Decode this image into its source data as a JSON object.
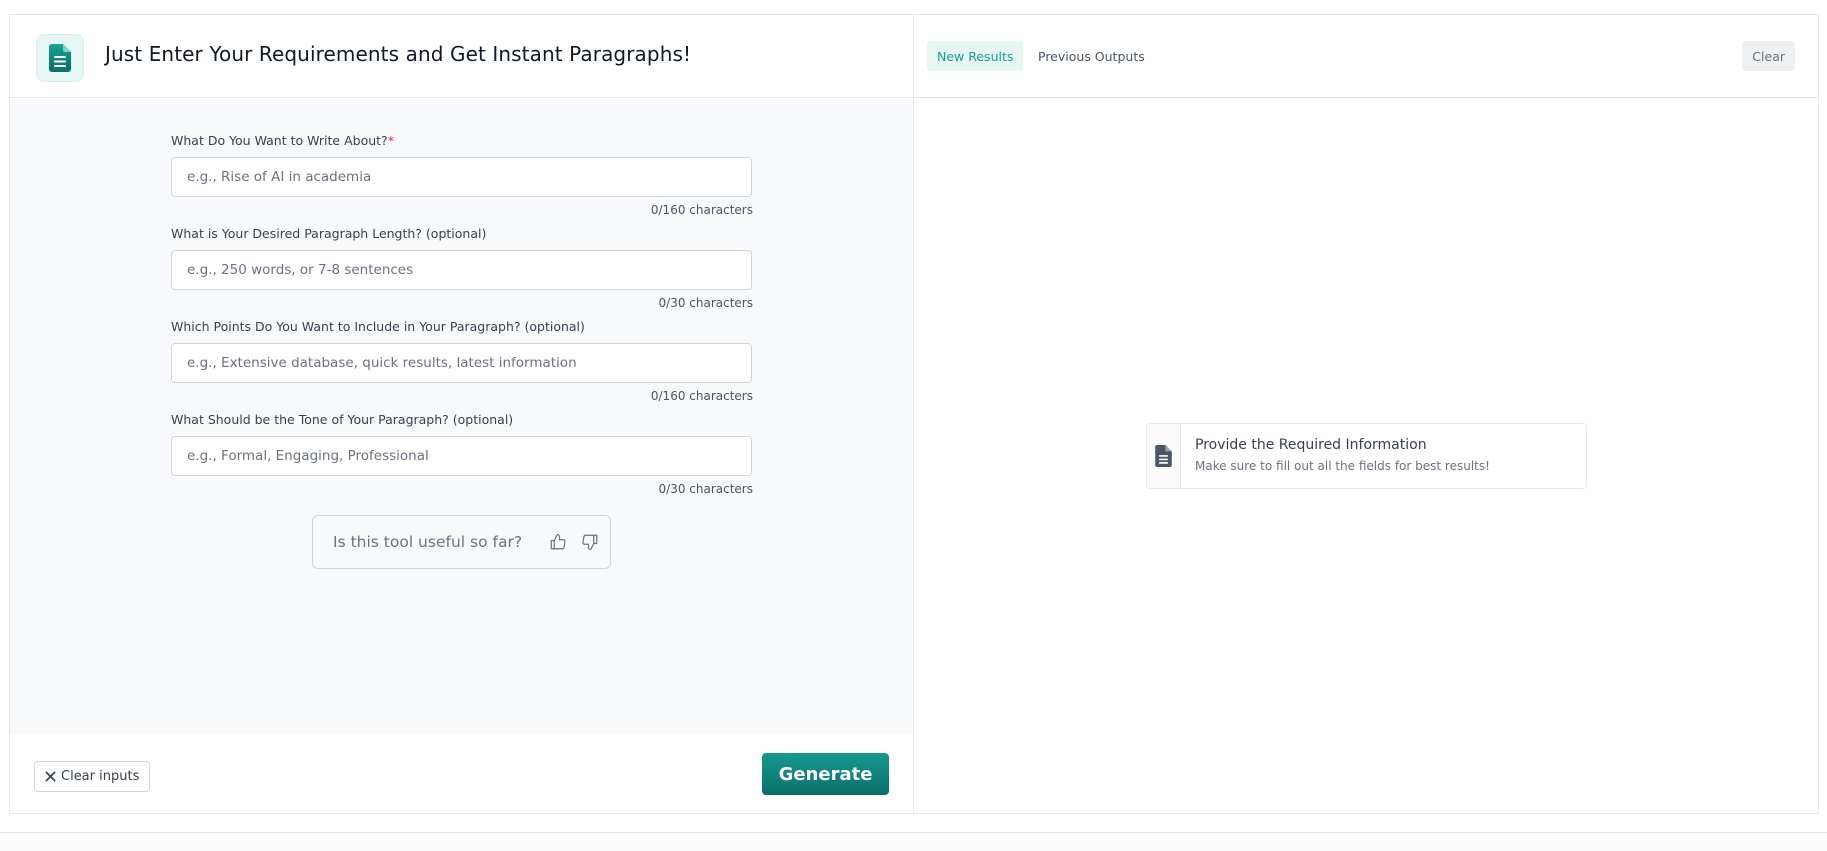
{
  "header": {
    "title": "Just Enter Your Requirements and Get Instant Paragraphs!",
    "app_icon": "document-icon"
  },
  "form": {
    "fields": [
      {
        "label": "What Do You Want to Write About?",
        "required_mark": "*",
        "placeholder": "e.g., Rise of AI in academia",
        "value": "",
        "count": "0/160 characters"
      },
      {
        "label": "What is Your Desired Paragraph Length? (optional)",
        "placeholder": "e.g., 250 words, or 7-8 sentences",
        "value": "",
        "count": "0/30 characters"
      },
      {
        "label": "Which Points Do You Want to Include in Your Paragraph? (optional)",
        "placeholder": "e.g., Extensive database, quick results, latest information",
        "value": "",
        "count": "0/160 characters"
      },
      {
        "label": "What Should be the Tone of Your Paragraph? (optional)",
        "placeholder": "e.g., Formal, Engaging, Professional",
        "value": "",
        "count": "0/30 characters"
      }
    ],
    "feedback": {
      "question": "Is this tool useful so far?",
      "up_icon": "thumbs-up-icon",
      "down_icon": "thumbs-down-icon"
    }
  },
  "footer": {
    "clear_inputs_label": "Clear inputs",
    "clear_inputs_icon": "close-icon",
    "generate_label": "Generate"
  },
  "results": {
    "tabs": [
      {
        "label": "New Results",
        "active": true
      },
      {
        "label": "Previous Outputs",
        "active": false
      }
    ],
    "clear_label": "Clear",
    "empty_state": {
      "icon": "document-icon",
      "title": "Provide the Required Information",
      "subtitle": "Make sure to fill out all the fields for best results!"
    }
  },
  "colors": {
    "accent": "#14a08f",
    "generate_button": "#0f857c",
    "required_mark": "#e11d48"
  }
}
